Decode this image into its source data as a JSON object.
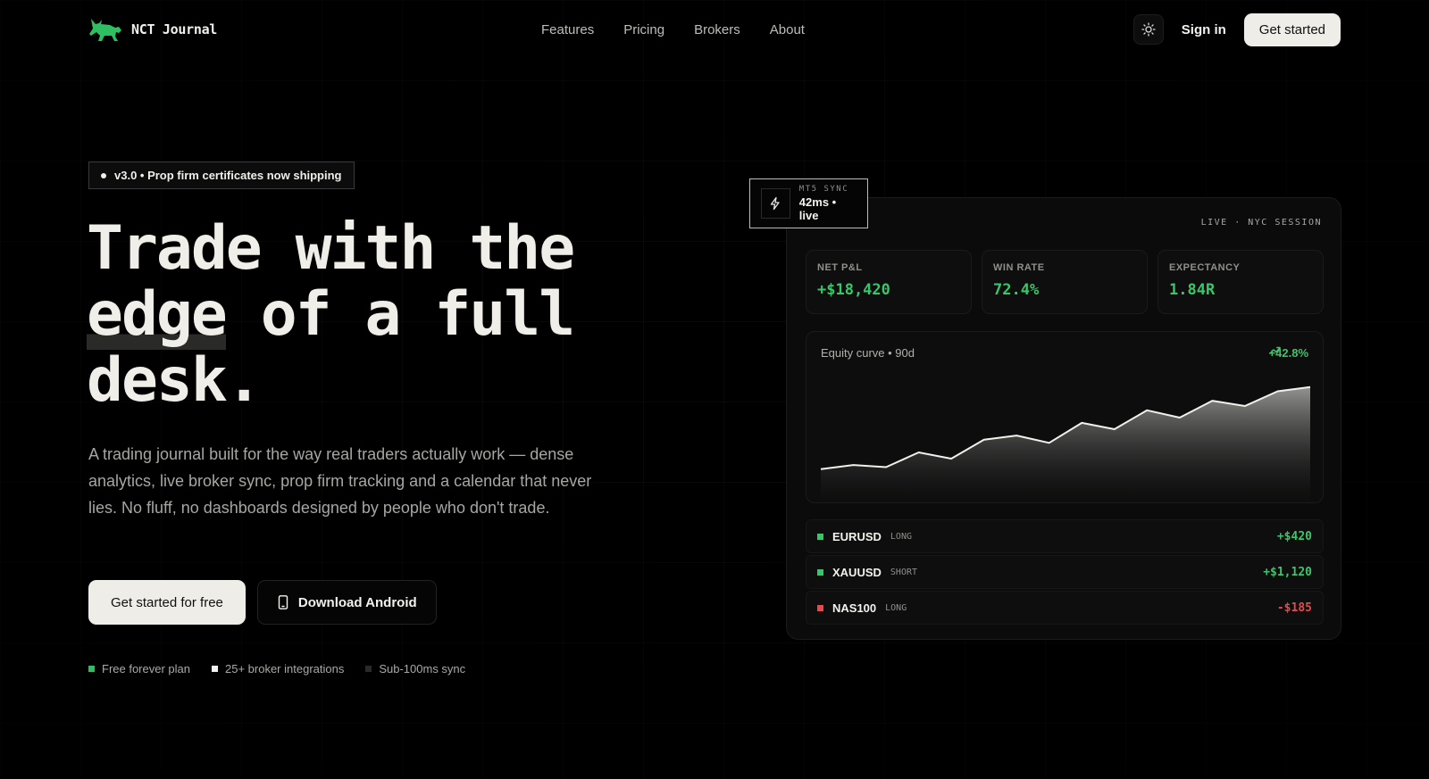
{
  "nav": {
    "brand": "NCT Journal",
    "links": [
      "Features",
      "Pricing",
      "Brokers",
      "About"
    ],
    "signin": "Sign in",
    "cta": "Get started"
  },
  "hero": {
    "badge": "v3.0 • Prop firm certificates now shipping",
    "headline_a": "Trade with the",
    "headline_b": "edge",
    "headline_c": " of a full",
    "headline_d": "desk.",
    "lede": "A trading journal built for the way real traders actually work — dense analytics, live broker sync, prop firm tracking and a calendar that never lies. No fluff, no dashboards designed by people who don't trade.",
    "cta_primary": "Get started for free",
    "cta_secondary": "Download Android",
    "features": [
      {
        "label": "Free forever plan",
        "color": "#2fbf63"
      },
      {
        "label": "25+ broker integrations",
        "color": "#f2f2ee"
      },
      {
        "label": "Sub-100ms sync",
        "color": "#2a2a2a"
      }
    ]
  },
  "dashboard": {
    "sync_label": "MT5 SYNC",
    "sync_value": "42ms • live",
    "session": "LIVE · NYC SESSION",
    "stats": [
      {
        "label": "NET P&L",
        "value": "+$18,420"
      },
      {
        "label": "WIN RATE",
        "value": "72.4%"
      },
      {
        "label": "EXPECTANCY",
        "value": "1.84R"
      }
    ],
    "equity_title": "Equity curve • 90d",
    "equity_delta": "+42.8%",
    "equity_values": [
      0.12,
      0.16,
      0.14,
      0.28,
      0.22,
      0.4,
      0.44,
      0.37,
      0.56,
      0.5,
      0.68,
      0.61,
      0.77,
      0.72,
      0.86,
      0.9
    ],
    "trades": [
      {
        "symbol": "EURUSD",
        "side": "LONG",
        "pnl": "+$420",
        "color": "#39c66b"
      },
      {
        "symbol": "XAUUSD",
        "side": "SHORT",
        "pnl": "+$1,120",
        "color": "#39c66b"
      },
      {
        "symbol": "NAS100",
        "side": "LONG",
        "pnl": "-$185",
        "color": "#e5484d"
      }
    ]
  },
  "colors": {
    "accent_green": "#39c66b",
    "loss_red": "#e5484d",
    "background": "#000000"
  }
}
